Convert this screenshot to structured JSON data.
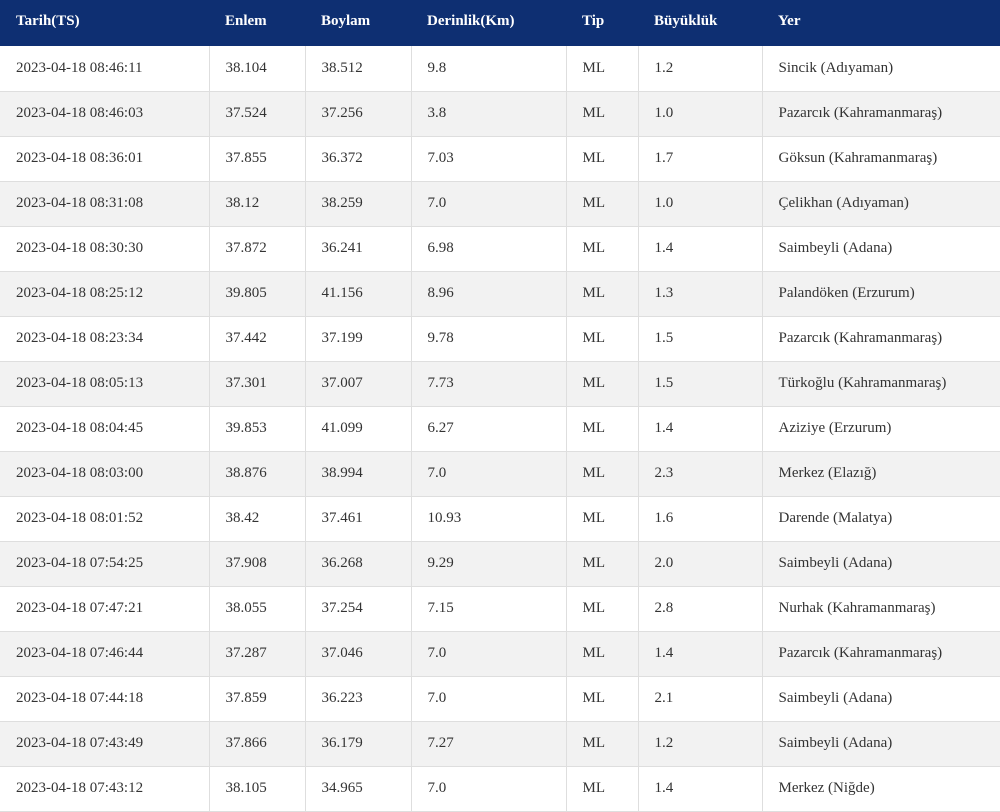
{
  "table": {
    "columns": [
      "Tarih(TS)",
      "Enlem",
      "Boylam",
      "Derinlik(Km)",
      "Tip",
      "Büyüklük",
      "Yer"
    ],
    "rows": [
      [
        "2023-04-18 08:46:11",
        "38.104",
        "38.512",
        "9.8",
        "ML",
        "1.2",
        "Sincik (Adıyaman)"
      ],
      [
        "2023-04-18 08:46:03",
        "37.524",
        "37.256",
        "3.8",
        "ML",
        "1.0",
        "Pazarcık (Kahramanmaraş)"
      ],
      [
        "2023-04-18 08:36:01",
        "37.855",
        "36.372",
        "7.03",
        "ML",
        "1.7",
        "Göksun (Kahramanmaraş)"
      ],
      [
        "2023-04-18 08:31:08",
        "38.12",
        "38.259",
        "7.0",
        "ML",
        "1.0",
        "Çelikhan (Adıyaman)"
      ],
      [
        "2023-04-18 08:30:30",
        "37.872",
        "36.241",
        "6.98",
        "ML",
        "1.4",
        "Saimbeyli (Adana)"
      ],
      [
        "2023-04-18 08:25:12",
        "39.805",
        "41.156",
        "8.96",
        "ML",
        "1.3",
        "Palandöken (Erzurum)"
      ],
      [
        "2023-04-18 08:23:34",
        "37.442",
        "37.199",
        "9.78",
        "ML",
        "1.5",
        "Pazarcık (Kahramanmaraş)"
      ],
      [
        "2023-04-18 08:05:13",
        "37.301",
        "37.007",
        "7.73",
        "ML",
        "1.5",
        "Türkoğlu (Kahramanmaraş)"
      ],
      [
        "2023-04-18 08:04:45",
        "39.853",
        "41.099",
        "6.27",
        "ML",
        "1.4",
        "Aziziye (Erzurum)"
      ],
      [
        "2023-04-18 08:03:00",
        "38.876",
        "38.994",
        "7.0",
        "ML",
        "2.3",
        "Merkez (Elazığ)"
      ],
      [
        "2023-04-18 08:01:52",
        "38.42",
        "37.461",
        "10.93",
        "ML",
        "1.6",
        "Darende (Malatya)"
      ],
      [
        "2023-04-18 07:54:25",
        "37.908",
        "36.268",
        "9.29",
        "ML",
        "2.0",
        "Saimbeyli (Adana)"
      ],
      [
        "2023-04-18 07:47:21",
        "38.055",
        "37.254",
        "7.15",
        "ML",
        "2.8",
        "Nurhak (Kahramanmaraş)"
      ],
      [
        "2023-04-18 07:46:44",
        "37.287",
        "37.046",
        "7.0",
        "ML",
        "1.4",
        "Pazarcık (Kahramanmaraş)"
      ],
      [
        "2023-04-18 07:44:18",
        "37.859",
        "36.223",
        "7.0",
        "ML",
        "2.1",
        "Saimbeyli (Adana)"
      ],
      [
        "2023-04-18 07:43:49",
        "37.866",
        "36.179",
        "7.27",
        "ML",
        "1.2",
        "Saimbeyli (Adana)"
      ],
      [
        "2023-04-18 07:43:12",
        "38.105",
        "34.965",
        "7.0",
        "ML",
        "1.4",
        "Merkez (Niğde)"
      ]
    ]
  },
  "colors": {
    "header_background": "#0e2f72",
    "header_text": "#ffffff",
    "row_stripe": "#f2f2f2",
    "row_plain": "#ffffff",
    "cell_text": "#333333"
  }
}
